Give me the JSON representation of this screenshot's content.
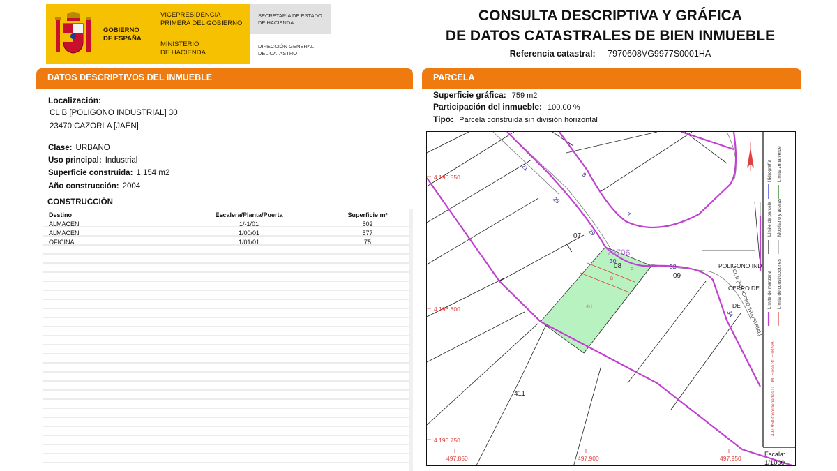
{
  "header": {
    "gov_line1": "GOBIERNO",
    "gov_line2": "DE ESPAÑA",
    "vice_line1": "VICEPRESIDENCIA",
    "vice_line2": "PRIMERA DEL GOBIERNO",
    "min_line1": "MINISTERIO",
    "min_line2": "DE HACIENDA",
    "sec_line1": "SECRETARÍA DE ESTADO",
    "sec_line2": "DE HACIENDA",
    "dg_line1": "DIRECCIÓN GENERAL",
    "dg_line2": "DEL CATASTRO",
    "title_line1": "CONSULTA DESCRIPTIVA Y GRÁFICA",
    "title_line2": "DE DATOS CATASTRALES DE BIEN INMUEBLE",
    "ref_label": "Referencia catastral:",
    "ref_value": "7970608VG9977S0001HA",
    "colors": {
      "orange": "#ef7a0f",
      "gold": "#f6c100",
      "parcel": "#b8f2c0",
      "boundary": "#c040d0"
    }
  },
  "descriptive": {
    "section_title": "DATOS DESCRIPTIVOS DEL INMUEBLE",
    "loc_label": "Localización:",
    "loc_line1": "CL B [POLIGONO INDUSTRIAL] 30",
    "loc_line2": "23470 CAZORLA [JAÉN]",
    "clase_label": "Clase:",
    "clase_value": "URBANO",
    "uso_label": "Uso principal:",
    "uso_value": "Industrial",
    "sup_label": "Superficie construida:",
    "sup_value": "1.154 m2",
    "anio_label": "Año construcción:",
    "anio_value": "2004",
    "constr_title": "CONSTRUCCIÓN",
    "table": {
      "headers": [
        "Destino",
        "Escalera/Planta/Puerta",
        "Superficie m²"
      ],
      "rows": [
        [
          "ALMACEN",
          "1/-1/01",
          "502"
        ],
        [
          "ALMACEN",
          "1/00/01",
          "577"
        ],
        [
          "OFICINA",
          "1/01/01",
          "75"
        ]
      ]
    }
  },
  "parcela": {
    "section_title": "PARCELA",
    "sup_label": "Superficie gráfica:",
    "sup_value": "759 m2",
    "part_label": "Participación del inmueble:",
    "part_value": "100,00 %",
    "tipo_label": "Tipo:",
    "tipo_value": "Parcela construida sin división horizontal"
  },
  "map": {
    "block_label": "79706",
    "parcels": [
      "07",
      "08",
      "09",
      "411"
    ],
    "street_numbers": [
      "21",
      "9",
      "25",
      "7",
      "29",
      "30",
      "32",
      "34"
    ],
    "street_label": "CL B [POLIGONO INDUSTRIAL]",
    "labels_right": [
      "POLIGONO IND",
      "CERRO DE",
      "DE"
    ],
    "y_coords": [
      "4.196.850",
      "4.196.800",
      "4.196.750"
    ],
    "x_coords": [
      "497.850",
      "497.900",
      "497.950"
    ],
    "coord_note": "497.950 Coordenadas U.T.M. Huso 30 ETRS89",
    "legend": [
      "Hidrografía",
      "Límite zona verde",
      "Límite de parcela",
      "Mobiliario y aceras",
      "Límite de manzana",
      "Límite de construcciones"
    ],
    "scale_label": "Escala:",
    "scale_value": "1/1000",
    "parcel_marks": [
      "P",
      "B",
      "-I+I"
    ]
  }
}
